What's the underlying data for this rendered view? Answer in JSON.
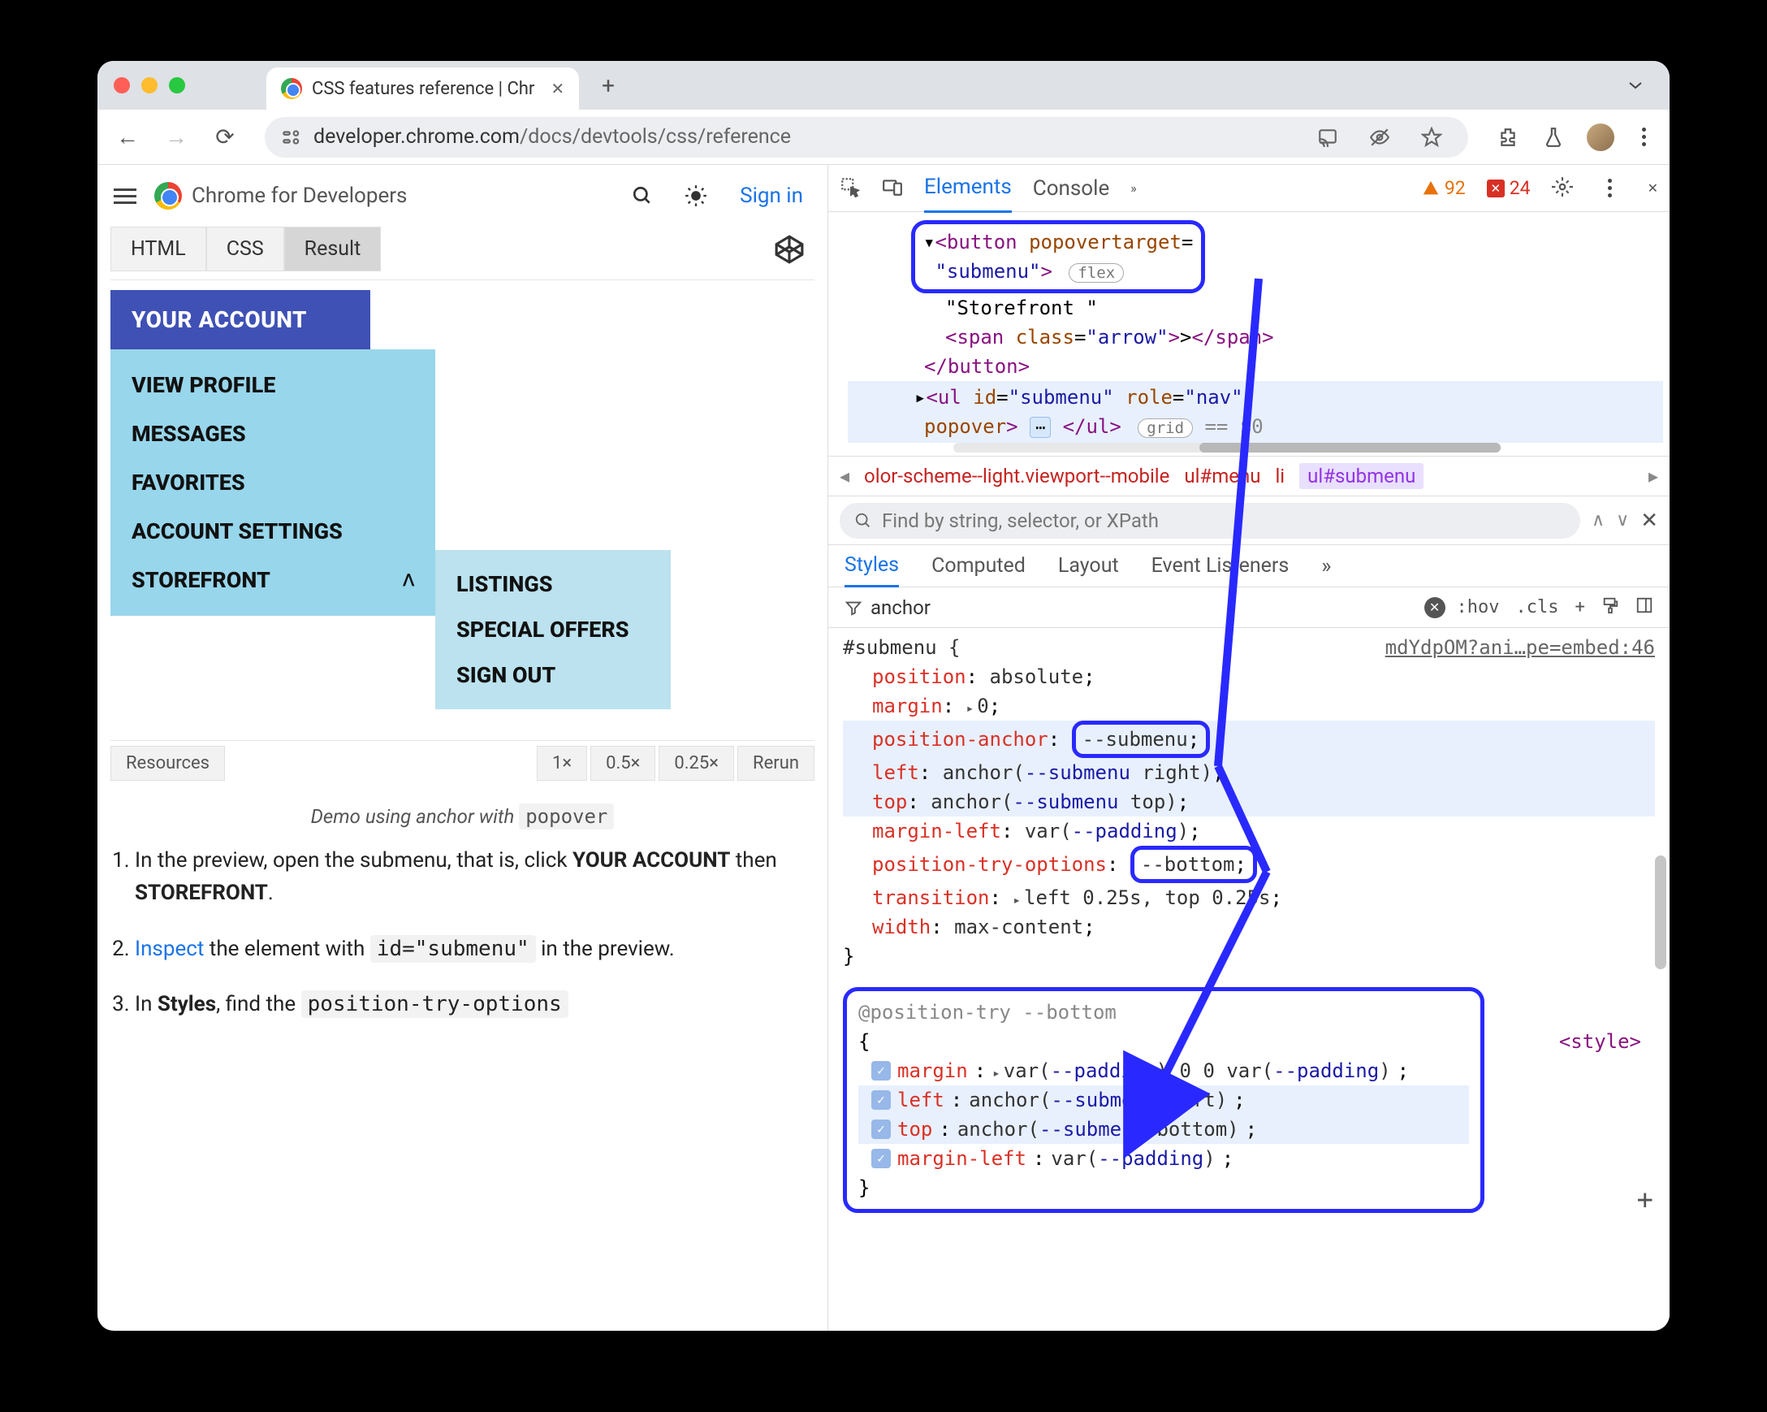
{
  "tab": {
    "title": "CSS features reference | Chr"
  },
  "url": {
    "host": "developer.chrome.com",
    "path": "/docs/devtools/css/reference"
  },
  "page_header": {
    "title": "Chrome for Developers",
    "signin": "Sign in"
  },
  "demo": {
    "tabs": [
      "HTML",
      "CSS",
      "Result"
    ],
    "active_tab": 2,
    "menu_header": "YOUR ACCOUNT",
    "menu_items": [
      "VIEW PROFILE",
      "MESSAGES",
      "FAVORITES",
      "ACCOUNT SETTINGS",
      "STOREFRONT"
    ],
    "submenu_items": [
      "LISTINGS",
      "SPECIAL OFFERS",
      "SIGN OUT"
    ],
    "zoom": {
      "resources": "Resources",
      "levels": [
        "1×",
        "0.5×",
        "0.25×"
      ],
      "rerun": "Rerun"
    },
    "caption_prefix": "Demo using anchor with ",
    "caption_code": "popover"
  },
  "steps": [
    {
      "pre": "In the preview, open the submenu, that is, click ",
      "b1": "YOUR ACCOUNT",
      "mid": " then ",
      "b2": "STOREFRONT",
      "post": "."
    },
    {
      "link": "Inspect",
      "mid": " the element with ",
      "code": "id=\"submenu\"",
      "post": " in the preview."
    },
    {
      "pre": "In ",
      "b1": "Styles",
      "mid": ", find the ",
      "code": "position-try-options"
    }
  ],
  "devtools": {
    "tabs": {
      "elements": "Elements",
      "console": "Console"
    },
    "badge_warn": "92",
    "badge_err": "24",
    "dom": {
      "callout_l1": "<button popovertarget=",
      "callout_l2_val": "\"submenu\"",
      "callout_l2_pill": "flex",
      "text_node": "\"Storefront \"",
      "span_open": "span",
      "span_class_attr": "class",
      "span_class_val": "\"arrow\"",
      "close_button": "button",
      "ul_tag": "ul",
      "ul_id_attr": "id",
      "ul_id_val": "\"submenu\"",
      "ul_role_attr": "role",
      "ul_role_val": "\"nav\"",
      "ul_popover_attr": "popover",
      "ul_pill": "grid",
      "eq": " == $0"
    },
    "breadcrumb": {
      "left_overflow": "olor-scheme--light.viewport--mobile",
      "items": [
        "ul#menu",
        "li",
        "ul#submenu"
      ]
    },
    "find_placeholder": "Find by string, selector, or XPath",
    "styles_tabs": [
      "Styles",
      "Computed",
      "Layout",
      "Event Listeners"
    ],
    "filter_value": "anchor",
    "style_actions": {
      "hov": ":hov",
      "cls": ".cls"
    },
    "rule": {
      "selector": "#submenu {",
      "source": "mdYdpOM?ani…pe=embed:46",
      "props": [
        {
          "name": "position",
          "value": "absolute",
          "hl": false
        },
        {
          "name": "margin",
          "value_prefix": "▸ ",
          "value": "0",
          "hl": false
        },
        {
          "name": "position-anchor",
          "value_callout": "--submenu",
          "hl": true
        },
        {
          "name": "left",
          "value_anchor_id": "--submenu",
          "value_anchor_side": "right",
          "hl": true
        },
        {
          "name": "top",
          "value_anchor_id": "--submenu",
          "value_anchor_side": "top",
          "hl": true
        },
        {
          "name": "margin-left",
          "value_var": "--padding",
          "hl": false
        },
        {
          "name": "position-try-options",
          "value_callout": "--bottom",
          "hl": false
        },
        {
          "name": "transition",
          "value_prefix": "▸ ",
          "value": "left 0.25s, top 0.25s",
          "hl": false
        },
        {
          "name": "width",
          "value": "max-content",
          "hl": false
        }
      ]
    },
    "position_try": {
      "header": "@position-try --bottom",
      "style_link": "<style>",
      "rows": [
        {
          "name": "margin",
          "raw": "▸ var(--padding) 0 0 var(--padding)",
          "hl": false
        },
        {
          "name": "left",
          "anchor_id": "--submenu",
          "anchor_side": "left",
          "hl": true
        },
        {
          "name": "top",
          "anchor_id": "--submenu",
          "anchor_side": "bottom",
          "hl": true
        },
        {
          "name": "margin-left",
          "var": "--padding",
          "hl": false
        }
      ]
    }
  }
}
